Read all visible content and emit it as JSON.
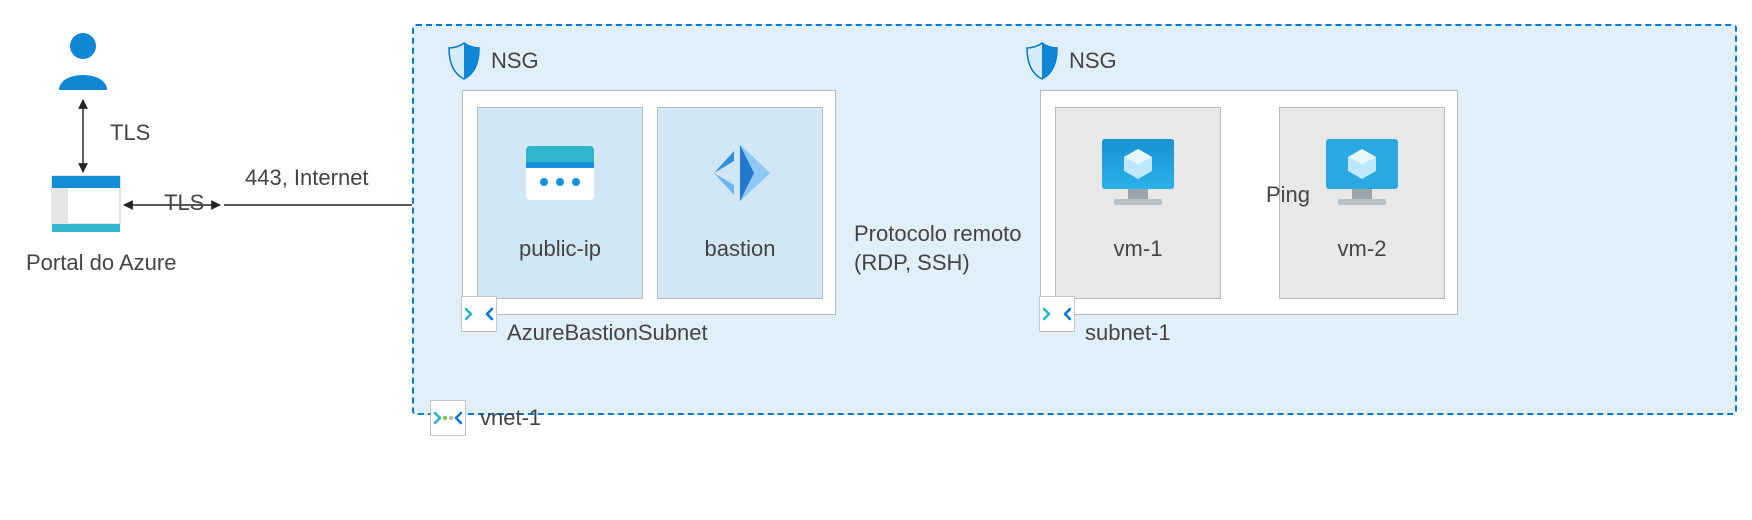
{
  "labels": {
    "portal": "Portal do Azure",
    "tls1": "TLS",
    "tls2": "TLS",
    "portInternet": "443, Internet",
    "nsg1": "NSG",
    "nsg2": "NSG",
    "publicIp": "public-ip",
    "bastion": "bastion",
    "bastionSubnet": "AzureBastionSubnet",
    "remoteProto": "Protocolo remoto\n(RDP, SSH)",
    "vm1": "vm-1",
    "vm2": "vm-2",
    "ping": "Ping",
    "subnet1": "subnet-1",
    "vnet": "vnet-1"
  },
  "colors": {
    "azureBlue": "#0078d4",
    "lightBlue": "#d1e7f6",
    "vnetFill": "#e1effa",
    "darkBlue": "#1490df",
    "teal": "#40c4d4",
    "gray": "#e8e8e8"
  }
}
